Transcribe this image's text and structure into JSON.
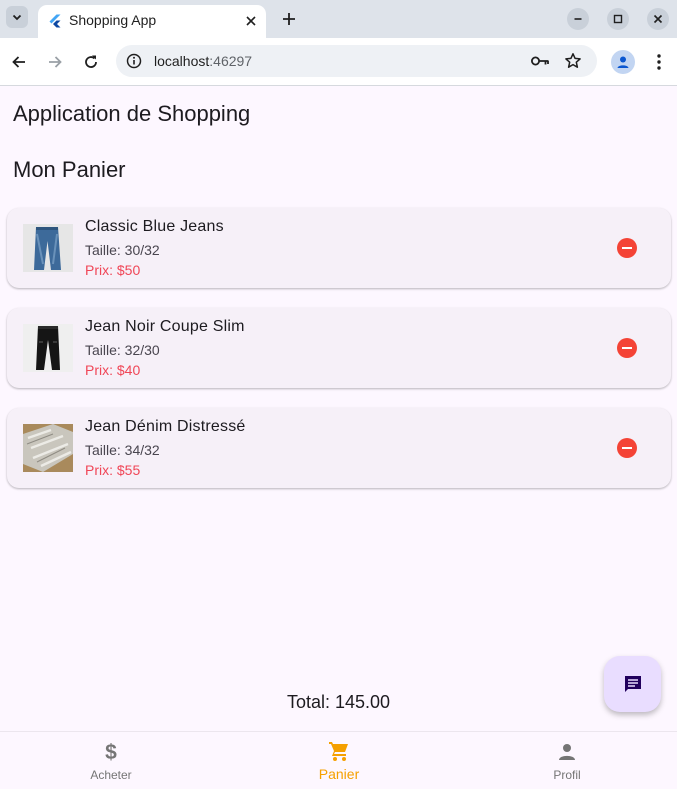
{
  "browser": {
    "tab_title": "Shopping App",
    "url_host": "localhost",
    "url_port": ":46297"
  },
  "app": {
    "title": "Application de Shopping",
    "section_title": "Mon Panier"
  },
  "cart": {
    "items": [
      {
        "name": "Classic Blue Jeans",
        "size": "Taille: 30/32",
        "price": "Prix: $50",
        "image": "blue-jeans"
      },
      {
        "name": "Jean Noir Coupe Slim",
        "size": "Taille: 32/30",
        "price": "Prix: $40",
        "image": "black-slim-jeans"
      },
      {
        "name": "Jean Dénim Distressé",
        "size": "Taille: 34/32",
        "price": "Prix: $55",
        "image": "distressed-denim"
      }
    ],
    "total": "Total: 145.00"
  },
  "bottom_nav": {
    "items": [
      {
        "label": "Acheter",
        "icon": "dollar-icon",
        "active": false
      },
      {
        "label": "Panier",
        "icon": "shopping-cart-icon",
        "active": true
      },
      {
        "label": "Profil",
        "icon": "person-icon",
        "active": false
      }
    ],
    "active_color": "#f5a000",
    "inactive_color": "#757575"
  },
  "colors": {
    "background": "#fdf7ff",
    "price": "#f04657",
    "remove": "#f44336",
    "fab": "#e9ddff"
  }
}
